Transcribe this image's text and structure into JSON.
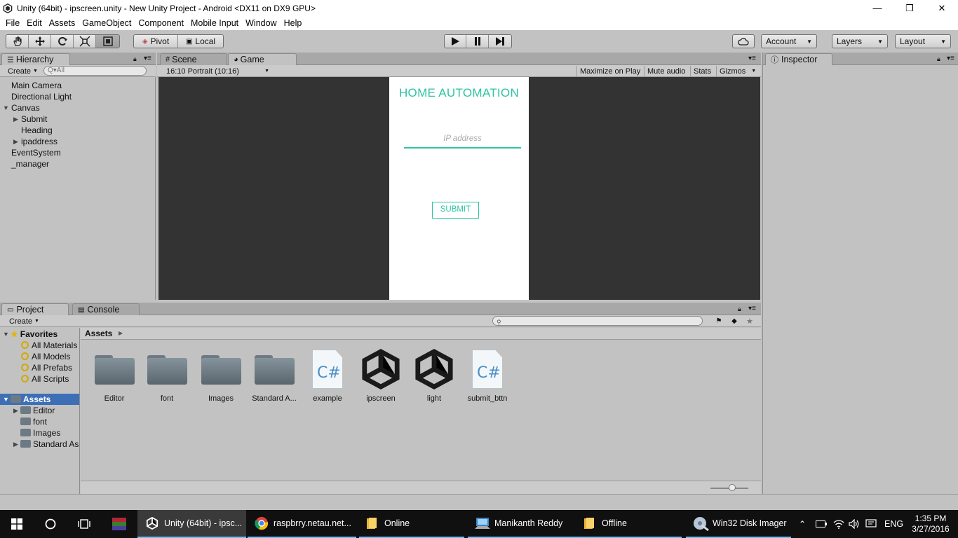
{
  "window": {
    "title": "Unity (64bit) - ipscreen.unity - New Unity Project - Android <DX11 on DX9 GPU>",
    "controls": {
      "minimize": "—",
      "restore": "❐",
      "close": "✕"
    }
  },
  "menu": [
    "File",
    "Edit",
    "Assets",
    "GameObject",
    "Component",
    "Mobile Input",
    "Window",
    "Help"
  ],
  "toolbar": {
    "pivot": "Pivot",
    "local": "Local",
    "account": "Account",
    "layers": "Layers",
    "layout": "Layout"
  },
  "hierarchy": {
    "tab": "Hierarchy",
    "create": "Create",
    "search_placeholder": "Q▾All",
    "items": [
      "Main Camera",
      "Directional Light",
      "Canvas",
      "Submit",
      "Heading",
      "ipaddress",
      "EventSystem",
      "_manager"
    ]
  },
  "scene_tab": "Scene",
  "game": {
    "tab": "Game",
    "aspect": "16:10 Portrait (10:16)",
    "maximize": "Maximize on Play",
    "mute": "Mute audio",
    "stats": "Stats",
    "gizmos": "Gizmos",
    "heading": "HOME AUTOMATION",
    "ip_placeholder": "IP address",
    "submit": "SUBMIT",
    "accent_color": "#2ec4a0"
  },
  "inspector": {
    "tab": "Inspector"
  },
  "project": {
    "tab": "Project",
    "console_tab": "Console",
    "create": "Create",
    "favorites_label": "Favorites",
    "favorites": [
      "All Materials",
      "All Models",
      "All Prefabs",
      "All Scripts"
    ],
    "assets_label": "Assets",
    "tree": [
      "Editor",
      "font",
      "Images",
      "Standard As"
    ],
    "breadcrumb": "Assets",
    "assets": [
      {
        "name": "Editor",
        "kind": "folder"
      },
      {
        "name": "font",
        "kind": "folder"
      },
      {
        "name": "Images",
        "kind": "folder"
      },
      {
        "name": "Standard A...",
        "kind": "folder"
      },
      {
        "name": "example",
        "kind": "script"
      },
      {
        "name": "ipscreen",
        "kind": "scene"
      },
      {
        "name": "light",
        "kind": "scene"
      },
      {
        "name": "submit_bttn",
        "kind": "script"
      }
    ]
  },
  "taskbar": {
    "items": [
      {
        "label": "Unity (64bit) - ipsc...",
        "icon": "unity-icon"
      },
      {
        "label": "raspbrry.netau.net...",
        "icon": "chrome-icon"
      },
      {
        "label": "Online",
        "icon": "folder-icon"
      },
      {
        "label": "Manikanth Reddy",
        "icon": "computer-icon"
      },
      {
        "label": "Offline",
        "icon": "folder-icon"
      },
      {
        "label": "Win32 Disk Imager",
        "icon": "disk-imager-icon"
      }
    ],
    "language": "ENG",
    "time": "1:35 PM",
    "date": "3/27/2016"
  }
}
